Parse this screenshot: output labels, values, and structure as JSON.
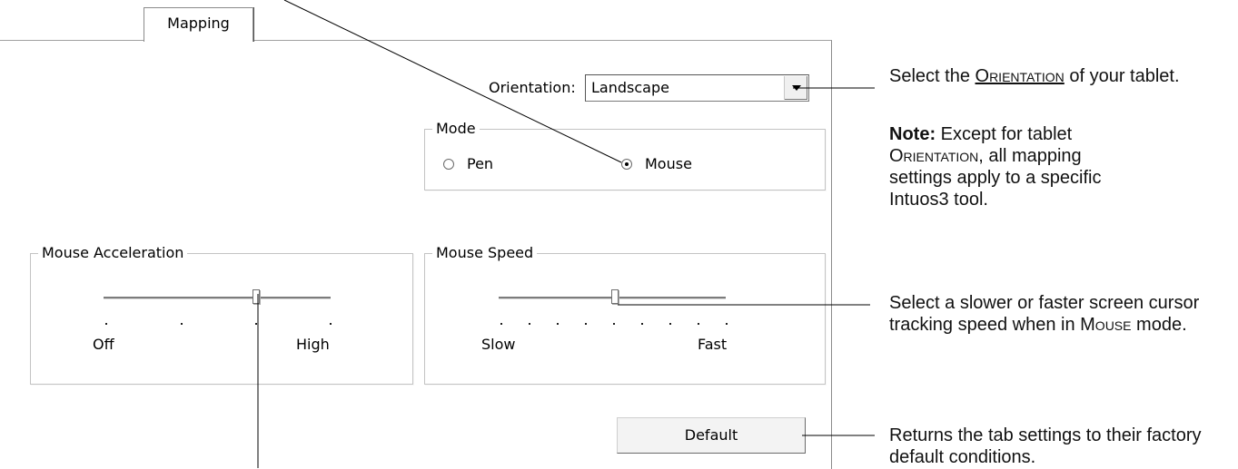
{
  "tab": {
    "label": "Mapping"
  },
  "orientation": {
    "label": "Orientation:",
    "value": "Landscape"
  },
  "mode": {
    "title": "Mode",
    "options": [
      {
        "label": "Pen",
        "selected": false
      },
      {
        "label": "Mouse",
        "selected": true
      }
    ]
  },
  "acceleration": {
    "title": "Mouse Acceleration",
    "min_label": "Off",
    "max_label": "High",
    "steps": 4,
    "position": 3
  },
  "speed": {
    "title": "Mouse Speed",
    "min_label": "Slow",
    "max_label": "Fast",
    "steps": 9,
    "position": 4
  },
  "default_button": {
    "label": "Default"
  },
  "callouts": {
    "orientation": {
      "prefix": "Select the ",
      "term": "Orientation",
      "suffix": " of your tablet."
    },
    "note": {
      "bold": "Note:",
      "text_a": " Except for tablet ",
      "term": "Orientation",
      "text_b": ", all mapping settings apply to a specific Intuos3 tool."
    },
    "speed": {
      "text": "Select a slower or faster screen cursor tracking speed when in ",
      "term": "Mouse",
      "suffix": " mode."
    },
    "default": {
      "text": "Returns the tab settings to their factory default conditions."
    }
  }
}
